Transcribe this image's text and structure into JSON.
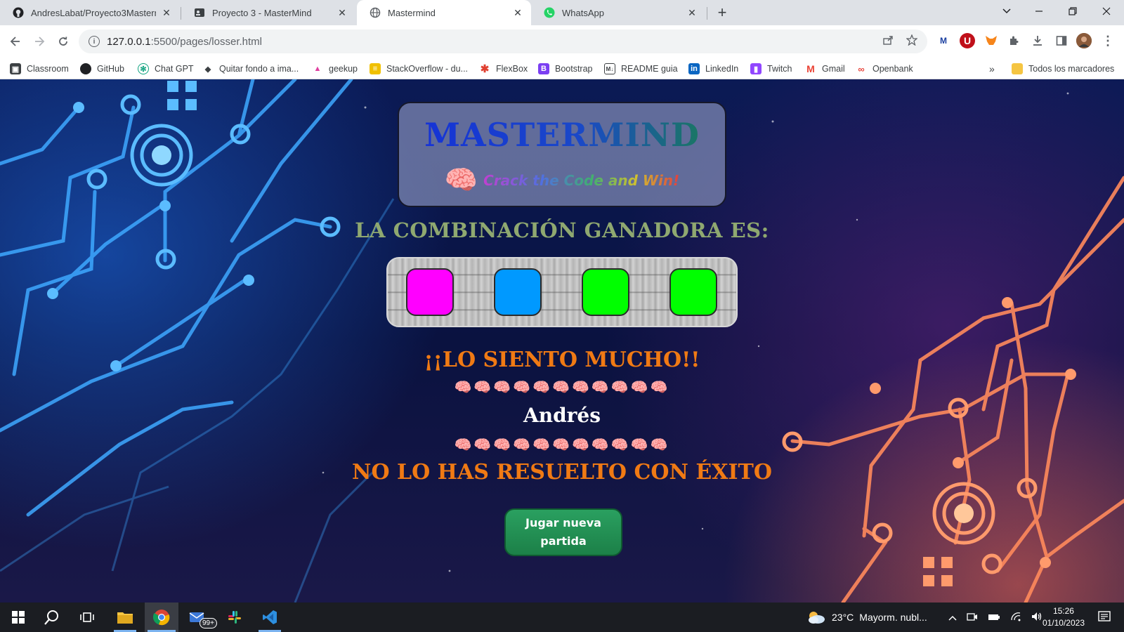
{
  "browser": {
    "tabs": [
      {
        "title": "AndresLabat/Proyecto3Masterm",
        "icon": "github-icon",
        "active": false
      },
      {
        "title": "Proyecto 3 - MasterMind",
        "icon": "page-icon",
        "active": false
      },
      {
        "title": "Mastermind",
        "icon": "globe-icon",
        "active": true
      },
      {
        "title": "WhatsApp",
        "icon": "whatsapp-icon",
        "active": false
      }
    ],
    "close_glyph": "✕",
    "new_tab_glyph": "+",
    "url_host": "127.0.0.1",
    "url_path": ":5500/pages/losser.html",
    "bookmarks": [
      {
        "label": "Classroom",
        "icon": "classroom-icon",
        "color": "#3c4043"
      },
      {
        "label": "GitHub",
        "icon": "github-icon",
        "color": "#202124"
      },
      {
        "label": "Chat GPT",
        "icon": "chatgpt-icon",
        "color": "#10a37f"
      },
      {
        "label": "Quitar fondo a ima...",
        "icon": "layers-icon",
        "color": "#3c4043"
      },
      {
        "label": "geekup",
        "icon": "geekup-icon",
        "color": "#e040a0"
      },
      {
        "label": "StackOverflow - du...",
        "icon": "stackoverflow-icon",
        "color": "#f0c000"
      },
      {
        "label": "FlexBox",
        "icon": "flexbox-icon",
        "color": "#e04030"
      },
      {
        "label": "Bootstrap",
        "icon": "bootstrap-icon",
        "color": "#7b3ff2"
      },
      {
        "label": "README guia",
        "icon": "markdown-icon",
        "color": "#3c4043"
      },
      {
        "label": "LinkedIn",
        "icon": "linkedin-icon",
        "color": "#0a66c2"
      },
      {
        "label": "Twitch",
        "icon": "twitch-icon",
        "color": "#9146ff"
      },
      {
        "label": "Gmail",
        "icon": "gmail-icon",
        "color": "#ea4335"
      },
      {
        "label": "Openbank",
        "icon": "openbank-icon",
        "color": "#e8453c"
      }
    ],
    "bookmarks_overflow": "»",
    "all_bookmarks": "Todos los marcadores"
  },
  "game": {
    "logo_title": "MASTERMIND",
    "logo_emoji": "🧠",
    "tagline": "Crack the Code and Win!",
    "combo_heading": "LA COMBINACIÓN GANADORA ES:",
    "pegs": [
      {
        "color": "#ff00ff",
        "name": "magenta"
      },
      {
        "color": "#0099ff",
        "name": "blue"
      },
      {
        "color": "#00ff00",
        "name": "green"
      },
      {
        "color": "#00ff00",
        "name": "green"
      }
    ],
    "sorry_text": "¡¡LO SIENTO MUCHO!!",
    "brain_row": "🧠🧠🧠🧠🧠🧠🧠🧠🧠🧠🧠",
    "player_name": "Andrés",
    "fail_text": "NO LO HAS RESUELTO CON ÉXITO",
    "new_game_label": "Jugar nueva partida"
  },
  "taskbar": {
    "weather_temp": "23°C",
    "weather_text": "Mayorm. nubl...",
    "mail_badge": "99+",
    "time": "15:26",
    "date": "01/10/2023"
  }
}
